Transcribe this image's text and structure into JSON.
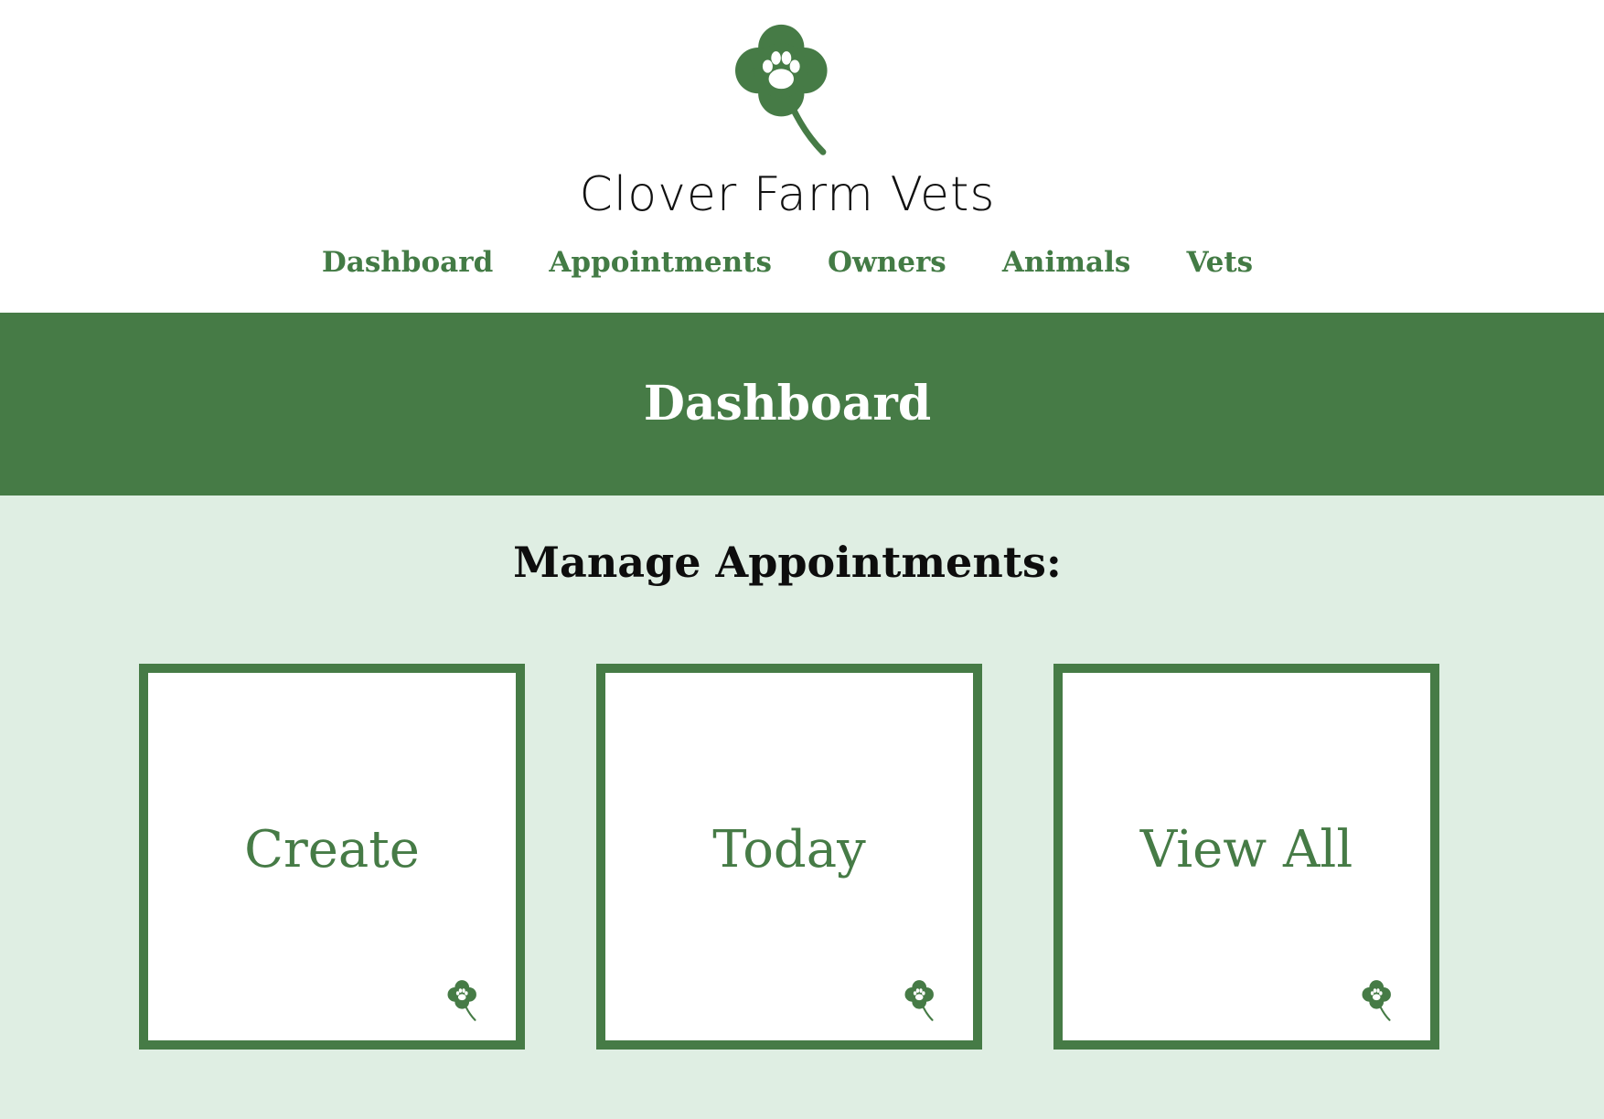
{
  "brand": {
    "name": "Clover Farm Vets",
    "logo_icon": "clover-paw-icon"
  },
  "nav": {
    "items": [
      {
        "label": "Dashboard"
      },
      {
        "label": "Appointments"
      },
      {
        "label": "Owners"
      },
      {
        "label": "Animals"
      },
      {
        "label": "Vets"
      }
    ]
  },
  "banner": {
    "title": "Dashboard"
  },
  "section": {
    "title": "Manage Appointments:"
  },
  "tiles": [
    {
      "label": "Create",
      "icon": "clover-paw-icon"
    },
    {
      "label": "Today",
      "icon": "clover-paw-icon"
    },
    {
      "label": "View All",
      "icon": "clover-paw-icon"
    }
  ],
  "colors": {
    "brand_green": "#467b46",
    "light_green_background": "#dfeee3",
    "header_background": "#ffffff"
  }
}
